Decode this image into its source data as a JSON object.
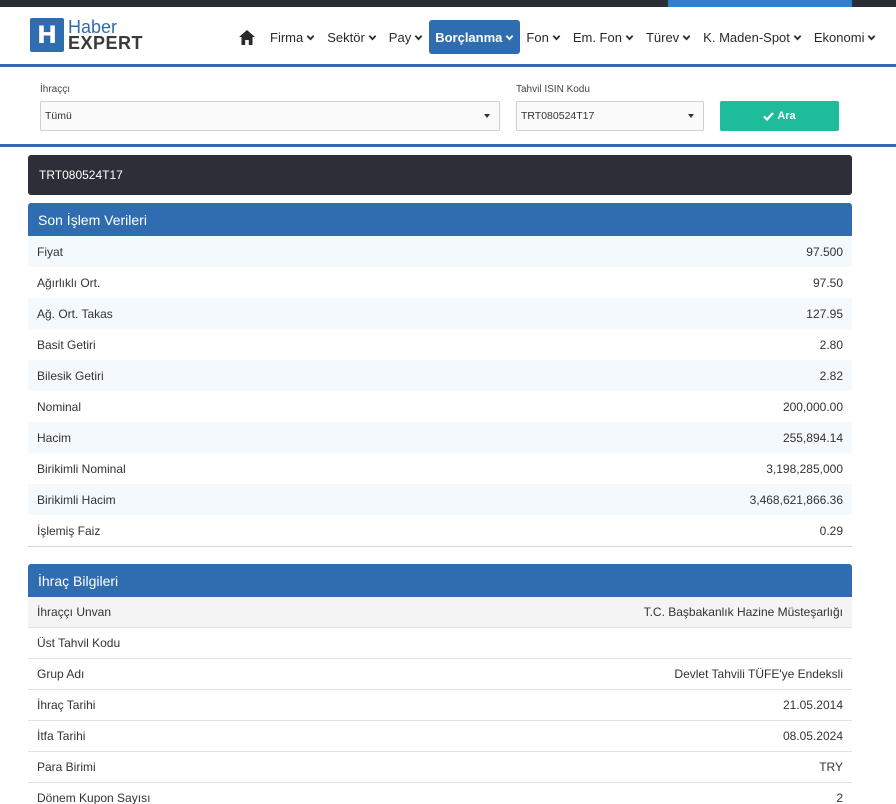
{
  "brand": {
    "logo_letter": "H",
    "line1": "Haber",
    "line2": "EXPERT"
  },
  "nav": {
    "home_icon": "home-icon",
    "items": [
      {
        "label": "Firma",
        "active": false
      },
      {
        "label": "Sektör",
        "active": false
      },
      {
        "label": "Pay",
        "active": false
      },
      {
        "label": "Borçlanma",
        "active": true
      },
      {
        "label": "Fon",
        "active": false
      },
      {
        "label": "Em. Fon",
        "active": false
      },
      {
        "label": "Türev",
        "active": false
      },
      {
        "label": "K. Maden-Spot",
        "active": false
      },
      {
        "label": "Ekonomi",
        "active": false
      }
    ]
  },
  "filter": {
    "issuer_label": "İhraççı",
    "issuer_value": "Tümü",
    "isin_label": "Tahvil ISIN Kodu",
    "isin_value": "TRT080524T17",
    "search_label": "Ara"
  },
  "isin_title": "TRT080524T17",
  "last_trade": {
    "title": "Son İşlem Verileri",
    "rows": [
      {
        "label": "Fiyat",
        "value": "97.500"
      },
      {
        "label": "Ağırlıklı Ort.",
        "value": "97.50"
      },
      {
        "label": "Ağ. Ort. Takas",
        "value": "127.95"
      },
      {
        "label": "Basit Getiri",
        "value": "2.80"
      },
      {
        "label": "Bilesik Getiri",
        "value": "2.82"
      },
      {
        "label": "Nominal",
        "value": "200,000.00"
      },
      {
        "label": "Hacim",
        "value": "255,894.14"
      },
      {
        "label": "Birikimli Nominal",
        "value": "3,198,285,000"
      },
      {
        "label": "Birikimli Hacim",
        "value": "3,468,621,866.36"
      },
      {
        "label": "İşlemiş Faiz",
        "value": "0.29"
      }
    ]
  },
  "issue_info": {
    "title": "İhraç Bilgileri",
    "rows": [
      {
        "label": "İhraççı Unvan",
        "value": "T.C. Başbakanlık Hazine Müsteşarlığı"
      },
      {
        "label": "Üst Tahvil Kodu",
        "value": ""
      },
      {
        "label": "Grup Adı",
        "value": "Devlet Tahvili TÜFE'ye Endeksli"
      },
      {
        "label": "İhraç Tarihi",
        "value": "21.05.2014"
      },
      {
        "label": "İtfa Tarihi",
        "value": "08.05.2024"
      },
      {
        "label": "Para Birimi",
        "value": "TRY"
      },
      {
        "label": "Dönem Kupon Sayısı",
        "value": "2"
      }
    ]
  },
  "colors": {
    "brand_blue": "#2f6db0",
    "dark_bar": "#2c2e38",
    "search_green": "#1fbc9c"
  }
}
